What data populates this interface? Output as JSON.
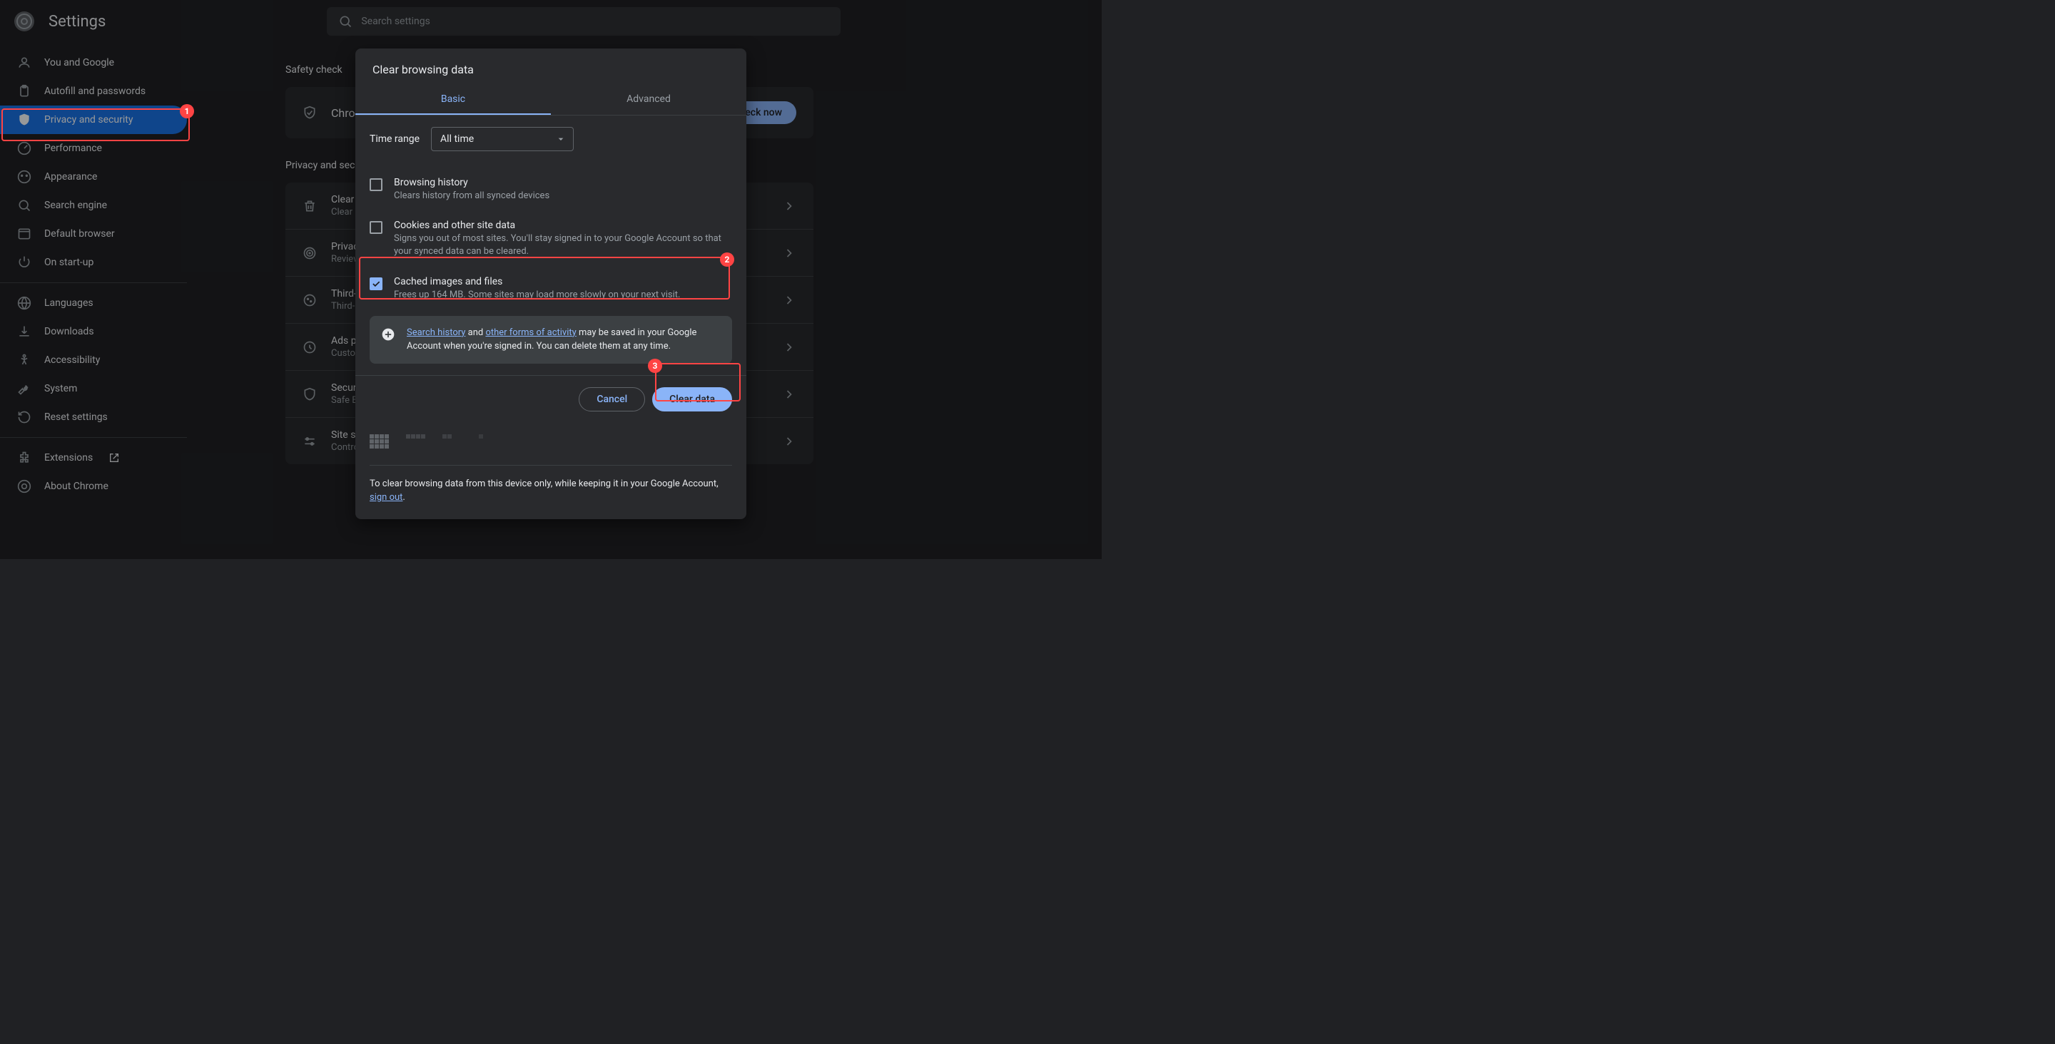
{
  "header": {
    "title": "Settings",
    "search_placeholder": "Search settings"
  },
  "sidebar": {
    "items": [
      {
        "label": "You and Google",
        "icon": "user"
      },
      {
        "label": "Autofill and passwords",
        "icon": "clipboard"
      },
      {
        "label": "Privacy and security",
        "icon": "shield",
        "active": true
      },
      {
        "label": "Performance",
        "icon": "speed"
      },
      {
        "label": "Appearance",
        "icon": "palette"
      },
      {
        "label": "Search engine",
        "icon": "search"
      },
      {
        "label": "Default browser",
        "icon": "browser"
      },
      {
        "label": "On start-up",
        "icon": "power"
      }
    ],
    "secondary": [
      {
        "label": "Languages",
        "icon": "globe"
      },
      {
        "label": "Downloads",
        "icon": "download"
      },
      {
        "label": "Accessibility",
        "icon": "accessibility"
      },
      {
        "label": "System",
        "icon": "wrench"
      },
      {
        "label": "Reset settings",
        "icon": "reset"
      }
    ],
    "footer": [
      {
        "label": "Extensions",
        "icon": "puzzle",
        "external": true
      },
      {
        "label": "About Chrome",
        "icon": "chrome"
      }
    ]
  },
  "main": {
    "safety_check_title": "Safety check",
    "safety_check_text": "Chrome...",
    "check_now": "Check now",
    "privacy_section_title": "Privacy and security",
    "rows": [
      {
        "title": "Clear browsing data",
        "subtitle": "Clear history, cookies, cache, and more"
      },
      {
        "title": "Privacy Guide",
        "subtitle": "Review your privacy settings"
      },
      {
        "title": "Third-party cookies",
        "subtitle": "Third-party cookies allowed"
      },
      {
        "title": "Ads privacy",
        "subtitle": "Customize the info used by sites to show you ads"
      },
      {
        "title": "Security",
        "subtitle": "Safe Browsing (protection from dangerous sites) and other security settings"
      },
      {
        "title": "Site settings",
        "subtitle": "Controls what information sites can use and show"
      }
    ]
  },
  "dialog": {
    "title": "Clear browsing data",
    "tabs": {
      "basic": "Basic",
      "advanced": "Advanced"
    },
    "time_range_label": "Time range",
    "time_range_value": "All time",
    "options": [
      {
        "title": "Browsing history",
        "subtitle": "Clears history from all synced devices",
        "checked": false
      },
      {
        "title": "Cookies and other site data",
        "subtitle": "Signs you out of most sites. You'll stay signed in to your Google Account so that your synced data can be cleared.",
        "checked": false
      },
      {
        "title": "Cached images and files",
        "subtitle": "Frees up 164 MB. Some sites may load more slowly on your next visit.",
        "checked": true
      }
    ],
    "info": {
      "search_history_link": "Search history",
      "and_text": " and ",
      "other_forms_link": "other forms of activity",
      "rest_text": " may be saved in your Google Account when you're signed in. You can delete them at any time."
    },
    "cancel": "Cancel",
    "clear_data": "Clear data",
    "bottom_text": "To clear browsing data from this device only, while keeping it in your Google Account, ",
    "sign_out_link": "sign out",
    "period": "."
  },
  "annotations": {
    "badge_1": "1",
    "badge_2": "2",
    "badge_3": "3"
  }
}
